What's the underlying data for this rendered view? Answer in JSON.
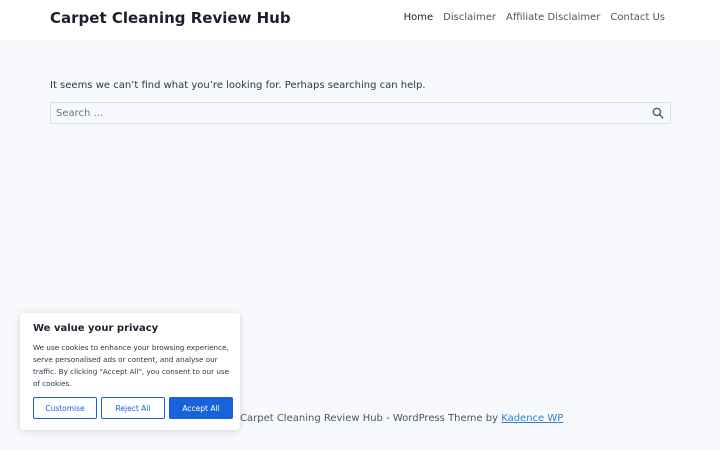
{
  "header": {
    "site_title": "Carpet Cleaning Review Hub",
    "nav": [
      {
        "label": "Home"
      },
      {
        "label": "Disclaimer"
      },
      {
        "label": "Affiliate Disclaimer"
      },
      {
        "label": "Contact Us"
      }
    ]
  },
  "main": {
    "notice": "It seems we can’t find what you’re looking for. Perhaps searching can help.",
    "search": {
      "placeholder": "Search …",
      "value": "",
      "icon": "search-icon"
    }
  },
  "footer": {
    "text": "Carpet Cleaning Review Hub - WordPress Theme by ",
    "link_label": "Kadence WP"
  },
  "cookie_banner": {
    "title": "We value your privacy",
    "text": "We use cookies to enhance your browsing experience, serve personalised ads or content, and analyse our traffic. By clicking \"Accept All\", you consent to our use of cookies.",
    "buttons": {
      "customise": "Customise",
      "reject": "Reject All",
      "accept": "Accept All"
    }
  },
  "colors": {
    "accent": "#1863dc",
    "link": "#3182ce",
    "background": "#f7f9fc"
  }
}
